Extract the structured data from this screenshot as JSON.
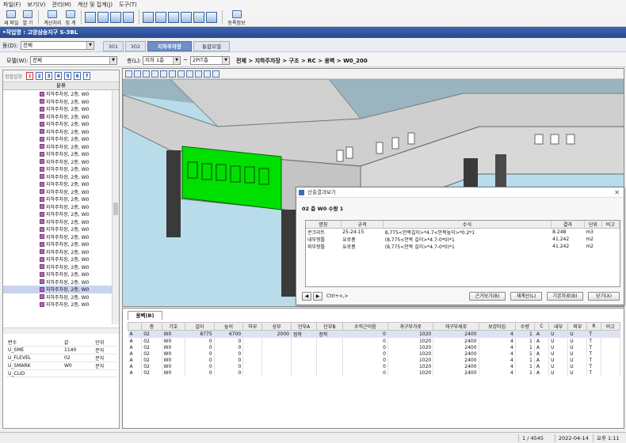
{
  "menu": [
    "파일(F)",
    "보기(V)",
    "관리(M)",
    "계산 및 집계(J)",
    "도구(T)"
  ],
  "toolbar": {
    "new_label": "새 파일",
    "open_label": "열 기",
    "calc_label": "계산처리",
    "sum_label": "집 계",
    "register_label": "등록정보"
  },
  "project": {
    "title": "•작업명 : 고양삼송지구 S-3BL"
  },
  "dong": {
    "label": "동(D):",
    "value": "전체",
    "tabs": [
      "301",
      "302",
      "지하주차장",
      "통합모델"
    ],
    "active_tab": "지하주차장"
  },
  "filter": {
    "model_label": "모델(W):",
    "model_value": "전체",
    "floor_label": "층(L):",
    "floor_from": "지하 1층",
    "tilde": "~",
    "floor_to": "2PIT층",
    "breadcrumb": "전체 > 지하주차장 > 구조 > RC > 옹벽 > W0_200"
  },
  "left": {
    "filter_label": "정렬설정",
    "nums": [
      "1",
      "2",
      "3",
      "4",
      "5",
      "6",
      "7"
    ],
    "tree_header": "분류",
    "item_label": "지하주차장, 2층, W0",
    "item_count": 29,
    "selected_index": 26,
    "props": {
      "headers": [
        "변수",
        "값",
        "단위"
      ],
      "rows": [
        [
          "U_SME",
          "1140",
          "문자"
        ],
        [
          "U_FLEVEL",
          "02",
          "문자"
        ],
        [
          "U_SMARK",
          "W0",
          "문자"
        ],
        [
          "U_CLID",
          "",
          ""
        ]
      ]
    }
  },
  "dialog": {
    "title": "산출결과보기",
    "heading": "02 층 W0 수량 1",
    "headers": [
      "명칭",
      "규격",
      "수식",
      "결과",
      "단위",
      "비고"
    ],
    "rows": [
      [
        "콘크리트",
        "25-24-15",
        "8,775<안목길이>*4.7<안목높이>*0.2*1",
        "8.248",
        "m3",
        ""
      ],
      [
        "내부형틀",
        "유로폼",
        "(8,775<안목 길이>*4.7-0*0)*1",
        "41.242",
        "m2",
        ""
      ],
      [
        "외부형틀",
        "유로폼",
        "(8,775<안목 길이>*4.7-0*0)*1",
        "41.242",
        "m2",
        ""
      ]
    ],
    "nav_hint": "Ctrl+<,>",
    "buttons": [
      "근거보기(B)",
      "재계산(L)",
      "기본자료(B)",
      "닫기(X)"
    ]
  },
  "grid": {
    "tab": "옹벽(B)",
    "headers": [
      "",
      "층",
      "기호",
      "길이",
      "높이",
      "하부",
      "상부",
      "단부A",
      "단부B",
      "수직근이음",
      "개구부가로",
      "개구부세로",
      "보강타입",
      "수량",
      "C",
      "내부",
      "외부",
      "R",
      "비고"
    ],
    "rows": [
      [
        "A",
        "02",
        "W0",
        "8775",
        "6700",
        "",
        "2000",
        "정착",
        "정착",
        "0",
        "1020",
        "2400",
        "4",
        "1",
        "A",
        "U",
        "U",
        "T",
        ""
      ],
      [
        "A",
        "02",
        "W0",
        "0",
        "0",
        "",
        "",
        "",
        "",
        "0",
        "1020",
        "2400",
        "4",
        "1",
        "A",
        "U",
        "U",
        "T",
        ""
      ],
      [
        "A",
        "02",
        "W0",
        "0",
        "0",
        "",
        "",
        "",
        "",
        "0",
        "1020",
        "2400",
        "4",
        "1",
        "A",
        "U",
        "U",
        "T",
        ""
      ],
      [
        "A",
        "02",
        "W0",
        "0",
        "0",
        "",
        "",
        "",
        "",
        "0",
        "1020",
        "2400",
        "4",
        "1",
        "A",
        "U",
        "U",
        "T",
        ""
      ],
      [
        "A",
        "02",
        "W0",
        "0",
        "0",
        "",
        "",
        "",
        "",
        "0",
        "1020",
        "2400",
        "4",
        "1",
        "A",
        "U",
        "U",
        "T",
        ""
      ],
      [
        "A",
        "02",
        "W0",
        "0",
        "0",
        "",
        "",
        "",
        "",
        "0",
        "1020",
        "2400",
        "4",
        "1",
        "A",
        "U",
        "U",
        "T",
        ""
      ],
      [
        "A",
        "02",
        "W0",
        "0",
        "0",
        "",
        "",
        "",
        "",
        "0",
        "1020",
        "2400",
        "4",
        "1",
        "A",
        "U",
        "U",
        "T",
        ""
      ]
    ]
  },
  "status": {
    "count": "1 / 4545",
    "date": "2022-04-14",
    "time": "오후 1:11"
  },
  "colors": {
    "accent": "#2a4a90",
    "highlight": "#00e000"
  }
}
